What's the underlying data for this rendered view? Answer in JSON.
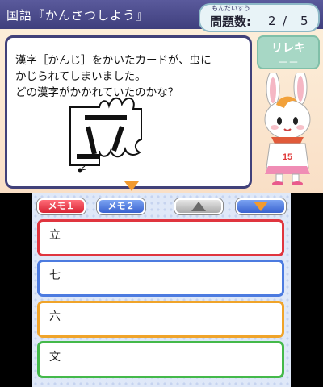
{
  "header": {
    "title": "国語『かんさつしよう』",
    "count_ruby": "もんだいすう",
    "count_label": "問題数:",
    "count_current": "2",
    "count_separator": "/",
    "count_total": "5"
  },
  "question": {
    "text": "漢字［かんじ］をかいたカードが、虫に\nかじられてしまいました。\nどの漢字がかかれていたのかな？"
  },
  "rireki": {
    "label": "リレキ",
    "value": "－－"
  },
  "mascot": {
    "shirt_number": "15"
  },
  "toolbar": {
    "memo1": "メモ１",
    "memo2": "メモ２"
  },
  "choices": [
    {
      "label": "立"
    },
    {
      "label": "七"
    },
    {
      "label": "六"
    },
    {
      "label": "文"
    }
  ],
  "colors": {
    "choice1": "#e0353f",
    "choice2": "#4c7be0",
    "choice3": "#f0a42a",
    "choice4": "#44b94a",
    "title_bar": "#4a4a8a"
  }
}
